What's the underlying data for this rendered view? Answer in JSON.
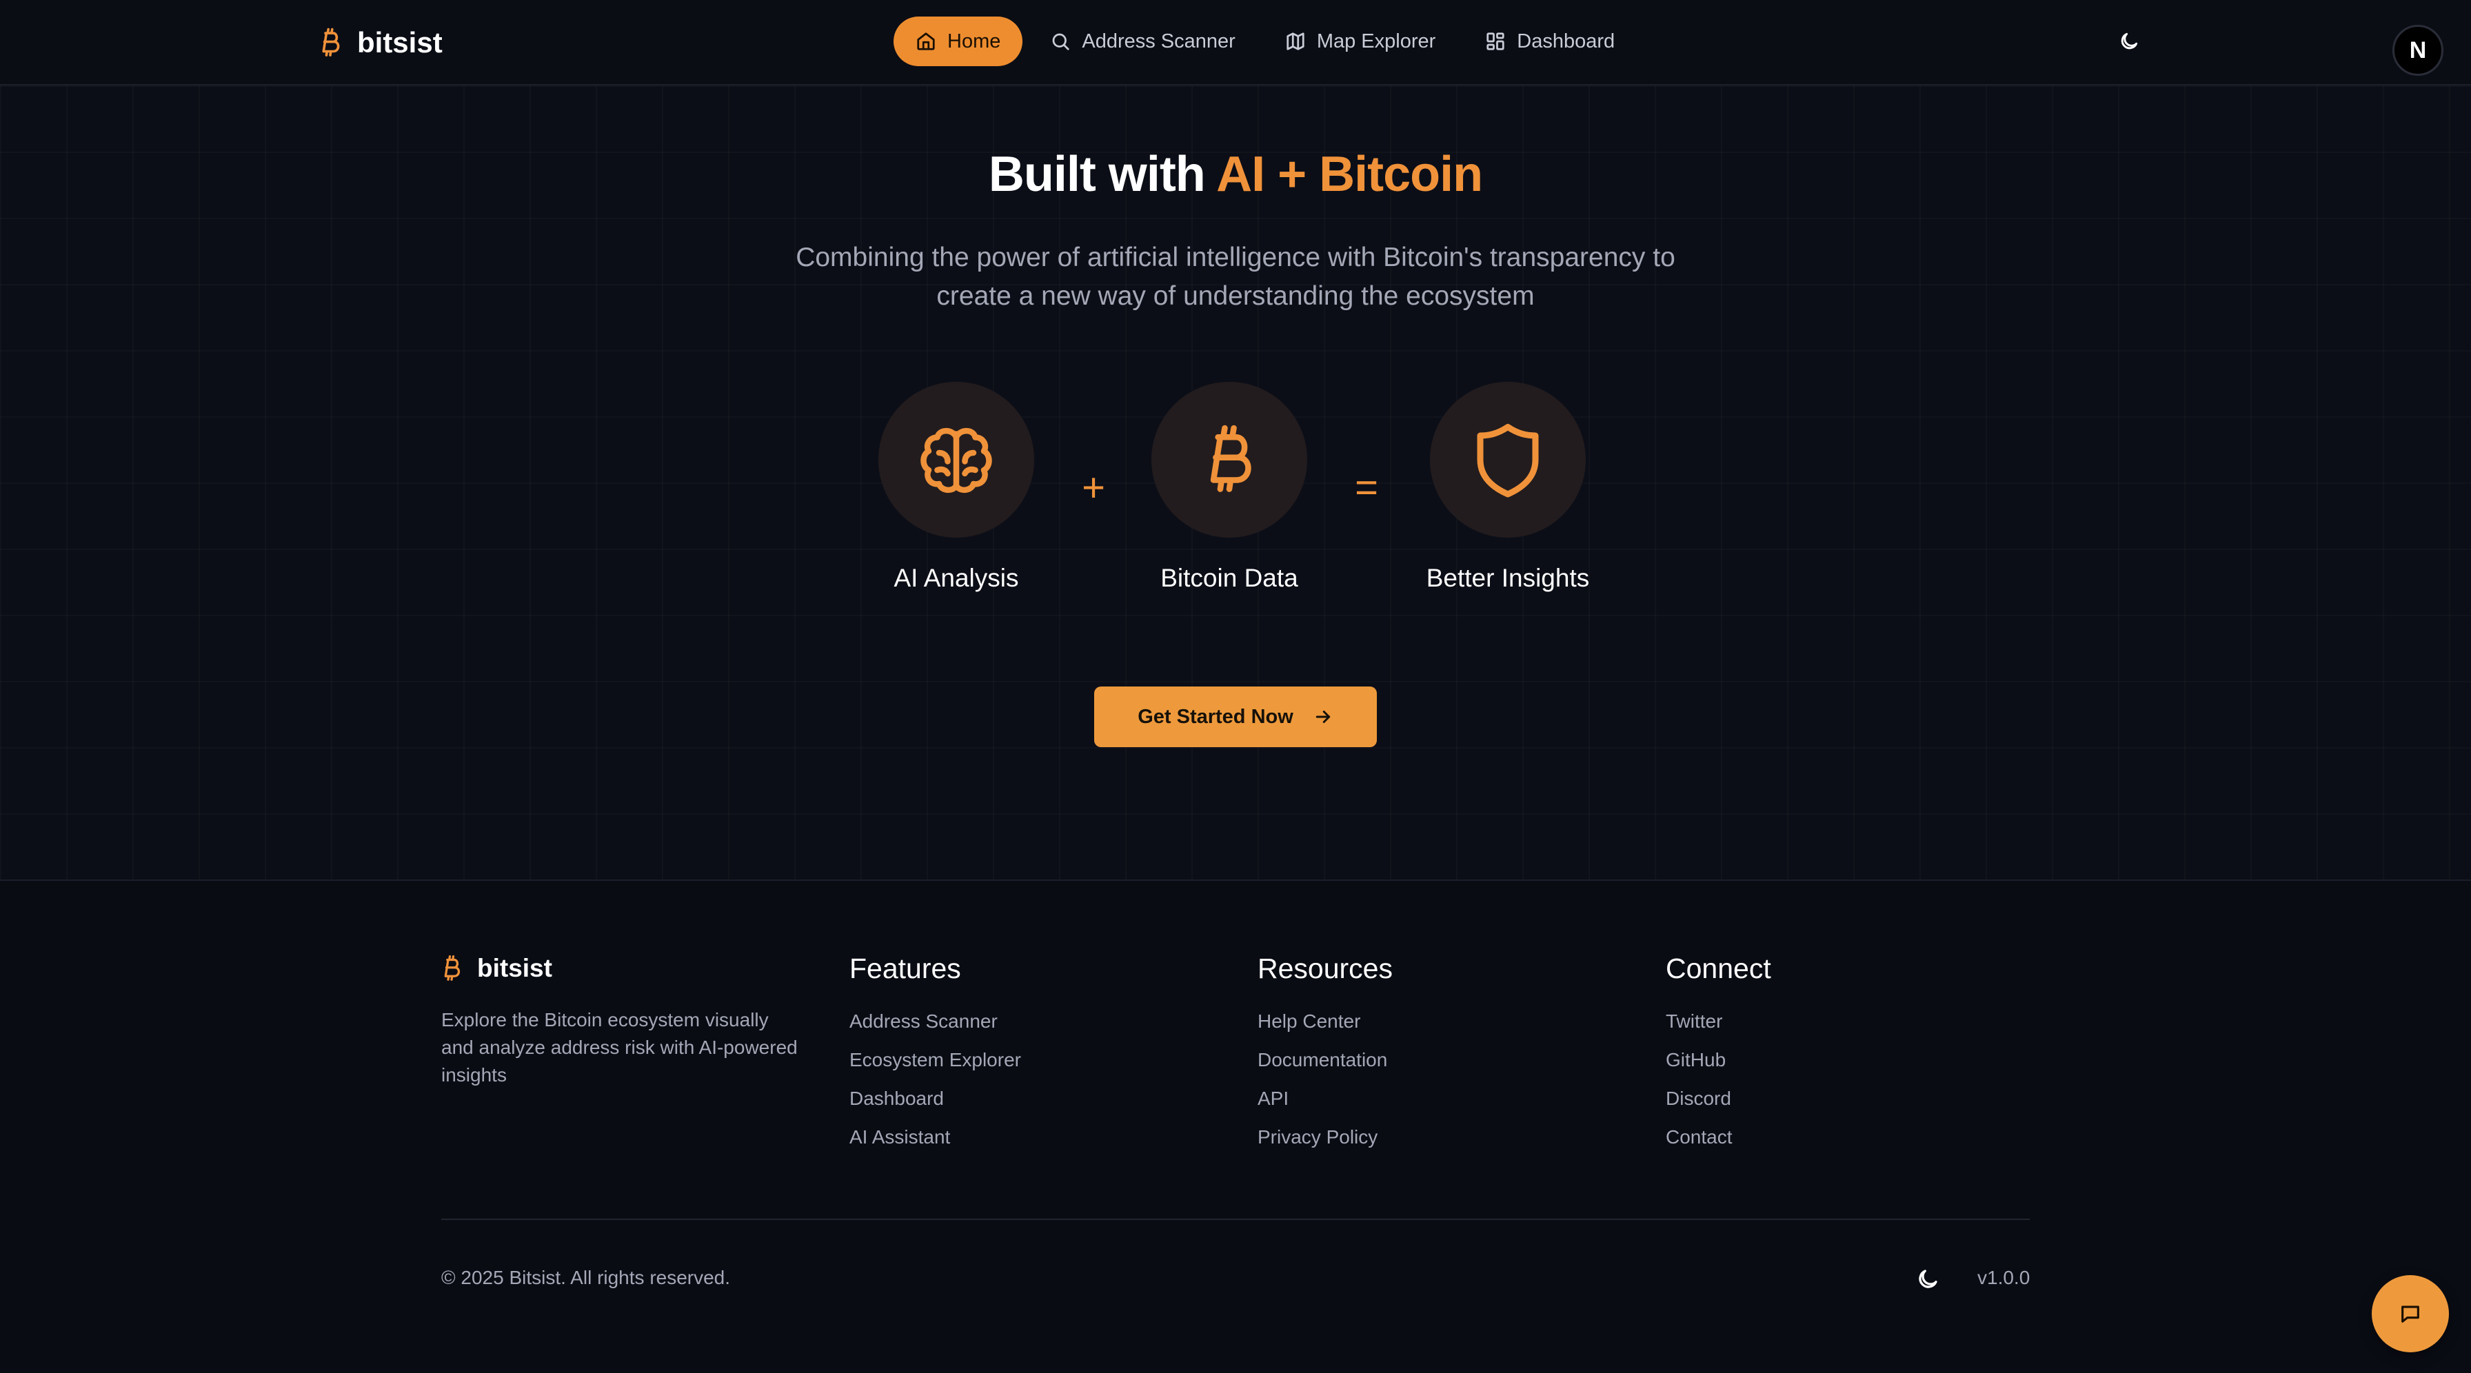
{
  "brand": {
    "name": "bitsist",
    "icon": "bitcoin-icon"
  },
  "nav": {
    "items": [
      {
        "label": "Home",
        "icon": "home-icon",
        "active": true
      },
      {
        "label": "Address Scanner",
        "icon": "search-icon",
        "active": false
      },
      {
        "label": "Map Explorer",
        "icon": "map-icon",
        "active": false
      },
      {
        "label": "Dashboard",
        "icon": "dashboard-icon",
        "active": false
      }
    ],
    "theme_icon": "moon-icon",
    "avatar_letter": "N"
  },
  "hero": {
    "title_prefix": "Built with ",
    "title_accent": "AI + Bitcoin",
    "subtitle": "Combining the power of artificial intelligence with Bitcoin's transparency to create a new way of understanding the ecosystem",
    "equation": {
      "items": [
        {
          "label": "AI Analysis",
          "icon": "brain-icon"
        },
        {
          "label": "Bitcoin Data",
          "icon": "bitcoin-icon"
        },
        {
          "label": "Better Insights",
          "icon": "shield-icon"
        }
      ],
      "plus": "+",
      "equals": "="
    },
    "cta_label": "Get Started Now",
    "cta_icon": "arrow-right-icon"
  },
  "footer": {
    "brand_name": "bitsist",
    "description": "Explore the Bitcoin ecosystem visually and analyze address risk with AI-powered insights",
    "columns": [
      {
        "heading": "Features",
        "links": [
          "Address Scanner",
          "Ecosystem Explorer",
          "Dashboard",
          "AI Assistant"
        ]
      },
      {
        "heading": "Resources",
        "links": [
          "Help Center",
          "Documentation",
          "API",
          "Privacy Policy"
        ]
      },
      {
        "heading": "Connect",
        "links": [
          "Twitter",
          "GitHub",
          "Discord",
          "Contact"
        ]
      }
    ],
    "copyright": "© 2025 Bitsist. All rights reserved.",
    "version": "v1.0.0"
  },
  "chat": {
    "icon": "chat-icon"
  },
  "colors": {
    "accent": "#f0923a",
    "background": "#0b0d15",
    "muted_text": "#a4a8b6"
  }
}
